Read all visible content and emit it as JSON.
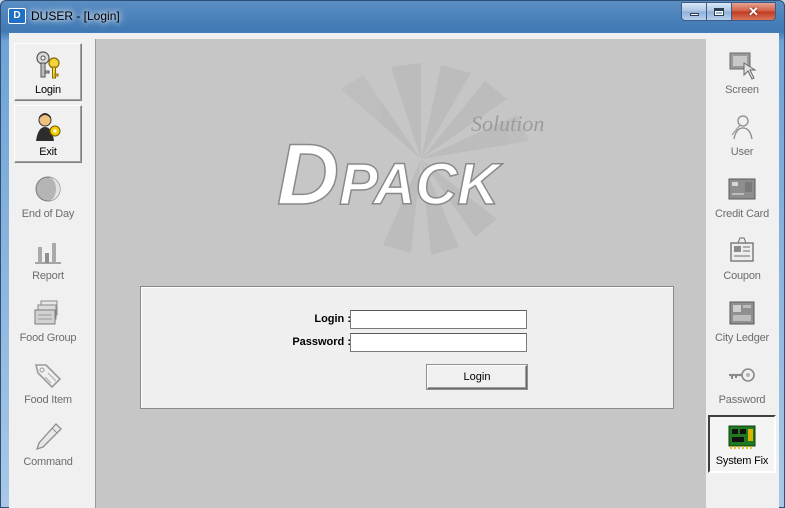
{
  "window": {
    "title": "DUSER - [Login]",
    "icon": "dpack-app-icon"
  },
  "left_toolbar": [
    {
      "label": "Login",
      "icon": "keys-icon",
      "state": "raised"
    },
    {
      "label": "Exit",
      "icon": "person-key-icon",
      "state": "raised"
    },
    {
      "label": "End of Day",
      "icon": "moon-icon",
      "state": "disabled"
    },
    {
      "label": "Report",
      "icon": "bar-chart-icon",
      "state": "disabled"
    },
    {
      "label": "Food Group",
      "icon": "folders-icon",
      "state": "disabled"
    },
    {
      "label": "Food Item",
      "icon": "tag-icon",
      "state": "disabled"
    },
    {
      "label": "Command",
      "icon": "pencil-icon",
      "state": "disabled"
    }
  ],
  "right_toolbar": [
    {
      "label": "Screen",
      "icon": "screen-hand-icon",
      "state": "disabled"
    },
    {
      "label": "User",
      "icon": "user-sketch-icon",
      "state": "disabled"
    },
    {
      "label": "Credit Card",
      "icon": "credit-card-icon",
      "state": "disabled"
    },
    {
      "label": "Coupon",
      "icon": "coupon-icon",
      "state": "disabled"
    },
    {
      "label": "City Ledger",
      "icon": "city-ledger-icon",
      "state": "disabled"
    },
    {
      "label": "Password",
      "icon": "key-icon",
      "state": "disabled"
    },
    {
      "label": "System Fix",
      "icon": "circuit-board-icon",
      "state": "pressed"
    }
  ],
  "logo": {
    "main_text": "DPACK",
    "script_text": "Solution"
  },
  "login_form": {
    "login_label": "Login :",
    "login_value": "",
    "password_label": "Password :",
    "password_value": "",
    "submit_label": "Login"
  }
}
